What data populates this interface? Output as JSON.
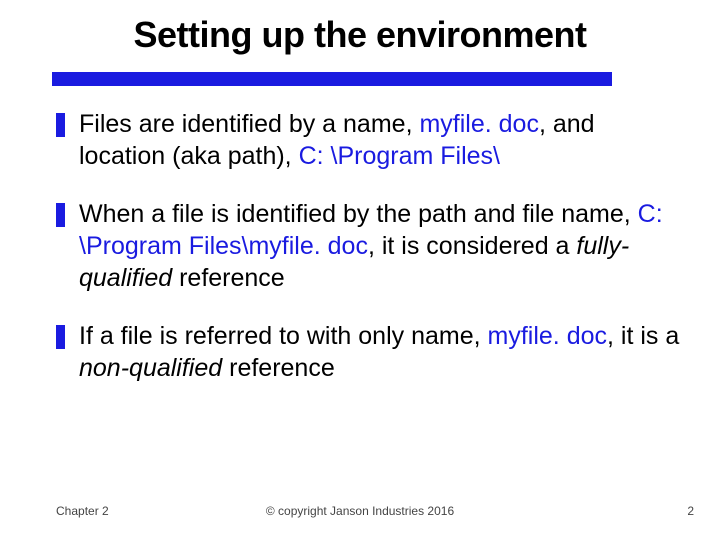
{
  "title": "Setting up the environment",
  "bullets": [
    {
      "pre1": "Files are identified by a name, ",
      "hl1": "myfile. doc",
      "mid1": ", and location (aka path), ",
      "hl2": "C: \\Program Files\\"
    },
    {
      "pre1": "When a file is identified by the path and file name, ",
      "hl1": "C: \\Program Files\\myfile. doc",
      "mid1": ", it is considered a ",
      "ital1": "fully-qualified",
      "post1": " reference"
    },
    {
      "pre1": "If a file is referred to with only name, ",
      "hl1": "myfile. doc",
      "mid1": ", it is a ",
      "ital1": "non-qualified",
      "post1": " reference"
    }
  ],
  "footer": {
    "left": "Chapter 2",
    "center": "© copyright Janson Industries 2016",
    "right": "2"
  }
}
